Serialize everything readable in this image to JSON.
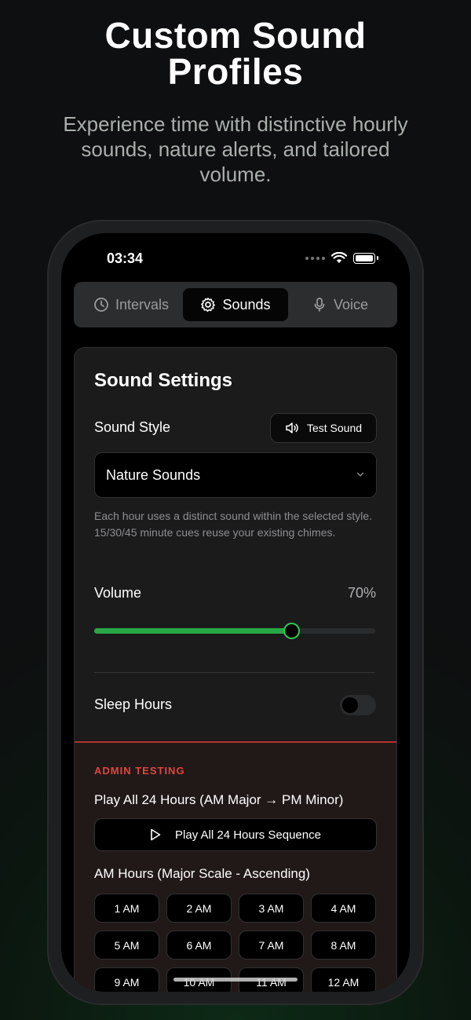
{
  "hero": {
    "title_line1": "Custom Sound",
    "title_line2": "Profiles",
    "subtitle": "Experience time with distinctive hourly sounds, nature alerts, and tailored volume."
  },
  "status_bar": {
    "time": "03:34"
  },
  "tabs": [
    {
      "label": "Intervals",
      "icon": "clock-icon",
      "active": false
    },
    {
      "label": "Sounds",
      "icon": "gear-icon",
      "active": true
    },
    {
      "label": "Voice",
      "icon": "microphone-icon",
      "active": false
    }
  ],
  "sound_settings": {
    "title": "Sound Settings",
    "sound_style_label": "Sound Style",
    "test_sound_label": "Test Sound",
    "selected_style": "Nature Sounds",
    "hint": "Each hour uses a distinct sound within the selected style. 15/30/45 minute cues reuse your existing chimes.",
    "volume_label": "Volume",
    "volume_text": "70%",
    "volume_fraction": 0.7,
    "sleep_hours_label": "Sleep Hours",
    "sleep_hours_on": false
  },
  "admin": {
    "label": "ADMIN TESTING",
    "play_all_title": "Play All 24 Hours (AM Major → PM Minor)",
    "play_all_button": "Play All 24 Hours Sequence",
    "am_title": "AM Hours (Major Scale - Ascending)",
    "am_hours": [
      "1 AM",
      "2 AM",
      "3 AM",
      "4 AM",
      "5 AM",
      "6 AM",
      "7 AM",
      "8 AM",
      "9 AM",
      "10 AM",
      "11 AM",
      "12 AM"
    ]
  },
  "colors": {
    "accent_green": "#27a745",
    "admin_red": "#e0463f"
  }
}
